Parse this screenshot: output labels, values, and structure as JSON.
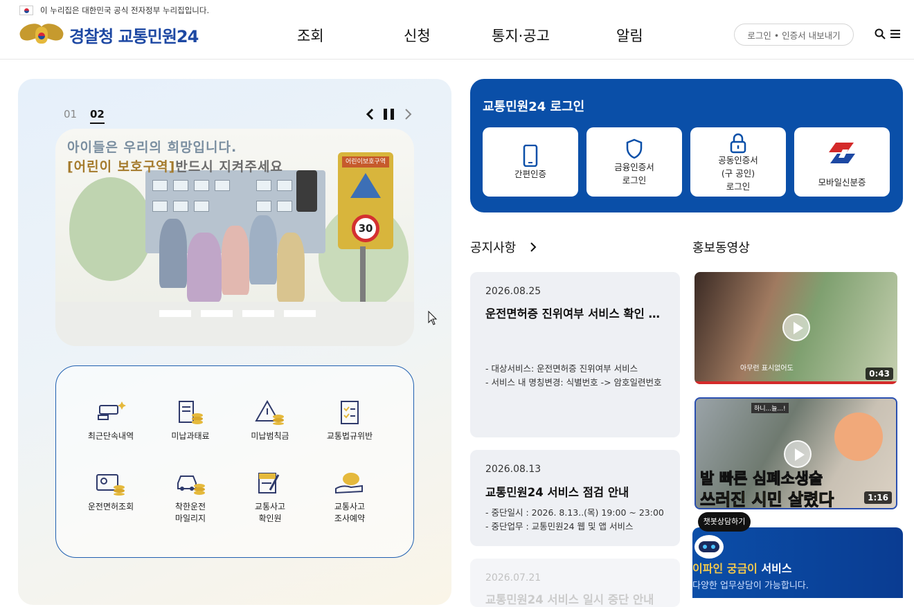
{
  "gov_banner": {
    "text": "이 누리집은 대한민국 공식 전자정부 누리집입니다."
  },
  "header": {
    "logo_text": "경찰청 교통민원24",
    "nav": [
      "조회",
      "신청",
      "통지·공고",
      "알림"
    ],
    "login_pill": "로그인 • 인증서 내보내기"
  },
  "slider": {
    "pages": [
      "01",
      "02"
    ],
    "active_page": "02",
    "banner_line1": "아이들은 우리의 희망입니다.",
    "banner_line2_bracket": "[어린이 보호구역]",
    "banner_line2_rest": "반드시 지켜주세요",
    "sign_label": "어린이보호구역",
    "speed": "30"
  },
  "quick_menu": [
    {
      "icon": "camera-icon",
      "label": "최근단속내역"
    },
    {
      "icon": "receipt-coins-icon",
      "label": "미납과태료"
    },
    {
      "icon": "warning-coins-icon",
      "label": "미납범칙금"
    },
    {
      "icon": "checklist-icon",
      "label": "교통법규위반"
    },
    {
      "icon": "id-card-coins-icon",
      "label": "운전면허조회"
    },
    {
      "icon": "car-coins-icon",
      "label": "착한운전\n마일리지"
    },
    {
      "icon": "document-pen-icon",
      "label": "교통사고\n확인원"
    },
    {
      "icon": "hand-piggy-icon",
      "label": "교통사고\n조사예약"
    }
  ],
  "login": {
    "title": "교통민원24 로그인",
    "buttons": [
      {
        "icon": "phone-icon",
        "label": "간편인증"
      },
      {
        "icon": "shield-icon",
        "label": "금융인증서\n로그인"
      },
      {
        "icon": "lock-icon",
        "label": "공동인증서\n(구 공인)\n로그인"
      },
      {
        "icon": "mobile-id-icon",
        "label": "모바일신분증"
      }
    ]
  },
  "notices": {
    "title": "공지사항",
    "items": [
      {
        "date": "2026.08.25",
        "title": "운전면허증 진위여부 서비스 확인 방법 변경 안내",
        "lines": [
          "- 대상서비스: 운전면허증 진위여부 서비스",
          "- 서비스 내 명칭변경: 식별번호 -> 암호일련번호"
        ]
      },
      {
        "date": "2026.08.13",
        "title": "교통민원24 서비스 점검 안내",
        "lines": [
          "- 중단일시 : 2026. 8.13..(목) 19:00 ~ 23:00",
          "- 중단업무 : 교통민원24 웹 및 앱 서비스"
        ]
      },
      {
        "date": "2026.07.21",
        "title": "교통민원24 서비스 일시 중단 안내",
        "lines": []
      }
    ]
  },
  "videos": {
    "title": "홍보동영상",
    "items": [
      {
        "duration": "0:43",
        "caption": "아무런 표시없어도"
      },
      {
        "duration": "1:16",
        "caption_top": "발 빠른 심폐소생술",
        "caption_bottom": "쓰러진 시민 살렸다",
        "bubble": "하니...늘...!"
      }
    ]
  },
  "chatbot": {
    "bubble": "챗봇상담하기",
    "title_accent": "이파인 궁금이",
    "title_rest": " 서비스",
    "subtitle": "다양한 업무상담이 가능합니다."
  },
  "colors": {
    "brand": "#0a4fa8",
    "accent": "#f2c94c"
  }
}
